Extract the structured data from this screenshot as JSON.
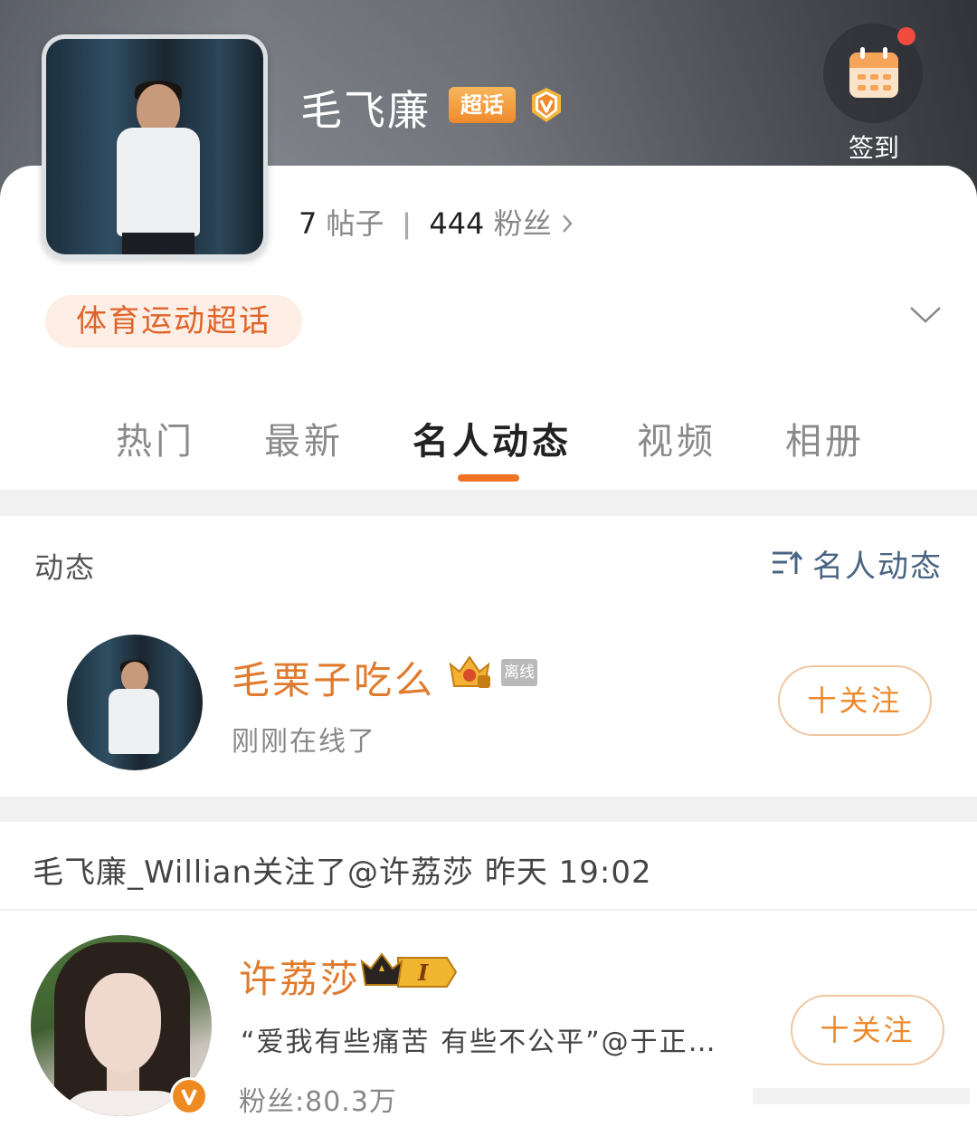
{
  "header": {
    "title": "毛飞廉",
    "super_tag": "超话",
    "checkin_label": "签到",
    "stats": {
      "posts_count": "7",
      "posts_label": "帖子",
      "fans_count": "444",
      "fans_label": "粉丝"
    },
    "category": "体育运动超话"
  },
  "tabs": [
    {
      "label": "热门",
      "active": false
    },
    {
      "label": "最新",
      "active": false
    },
    {
      "label": "名人动态",
      "active": true
    },
    {
      "label": "视频",
      "active": false
    },
    {
      "label": "相册",
      "active": false
    }
  ],
  "section1": {
    "label": "动态",
    "sort_label": "名人动态",
    "user": {
      "name": "毛栗子吃么",
      "status_tag": "离线",
      "subtitle": "刚刚在线了",
      "follow_label": "十关注"
    }
  },
  "section2": {
    "activity": "毛飞廉_Willian关注了@许荔莎 昨天 19:02",
    "user": {
      "name": "许荔莎",
      "rank_badge": "I",
      "quote": "“爱我有些痛苦 有些不公平”@于正…",
      "fans": "粉丝:80.3万",
      "follow_label": "十关注"
    }
  },
  "colors": {
    "accent": "#f07421",
    "name_orange": "#e07a2c",
    "link_blue": "#4a6583",
    "pill_bg": "#fdeee6"
  }
}
